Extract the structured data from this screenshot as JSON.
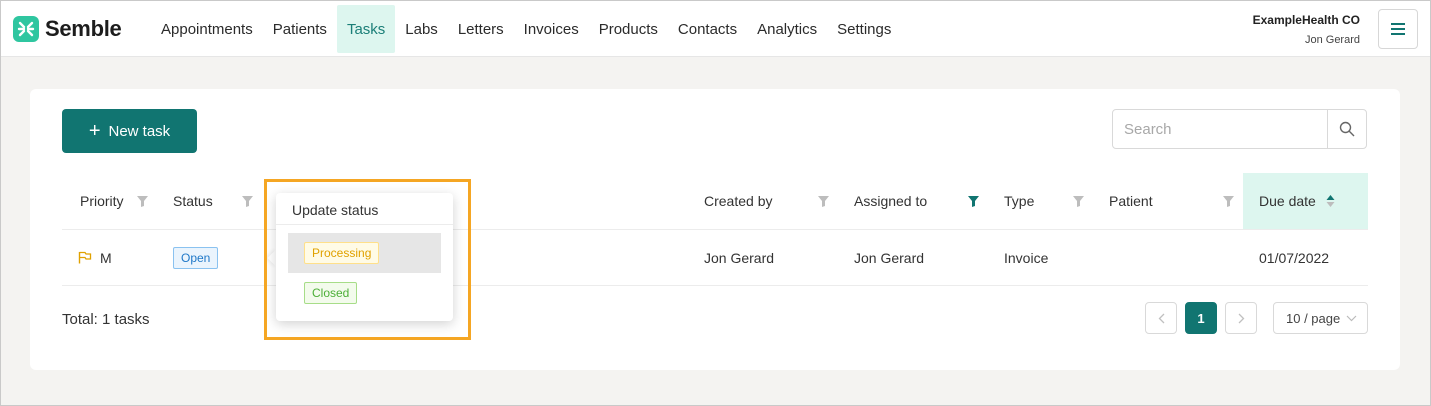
{
  "brand": {
    "name": "Semble",
    "color": "#2fc6a0",
    "icon": "semble-logo-icon"
  },
  "nav": [
    {
      "label": "Appointments",
      "active": false
    },
    {
      "label": "Patients",
      "active": false
    },
    {
      "label": "Tasks",
      "active": true
    },
    {
      "label": "Labs",
      "active": false
    },
    {
      "label": "Letters",
      "active": false
    },
    {
      "label": "Invoices",
      "active": false
    },
    {
      "label": "Products",
      "active": false
    },
    {
      "label": "Contacts",
      "active": false
    },
    {
      "label": "Analytics",
      "active": false
    },
    {
      "label": "Settings",
      "active": false
    }
  ],
  "account": {
    "org": "ExampleHealth CO",
    "user": "Jon Gerard"
  },
  "toolbar": {
    "new_task_label": "New task",
    "search_placeholder": "Search"
  },
  "table": {
    "columns": {
      "priority": "Priority",
      "status": "Status",
      "created_by": "Created by",
      "assigned_to": "Assigned to",
      "type": "Type",
      "patient": "Patient",
      "due_date": "Due date"
    },
    "rows": [
      {
        "priority": "M",
        "status": "Open",
        "created_by": "Jon Gerard",
        "assigned_to": "Jon Gerard",
        "type": "Invoice",
        "patient": "",
        "due_date": "01/07/2022"
      }
    ]
  },
  "popover": {
    "title": "Update status",
    "options": [
      "Processing",
      "Closed"
    ]
  },
  "footer": {
    "total": "Total: 1 tasks",
    "current_page": "1",
    "page_size": "10 / page"
  },
  "colors": {
    "primary": "#117571",
    "accent_bg": "#ddf6ef",
    "highlight": "#f5a623"
  }
}
